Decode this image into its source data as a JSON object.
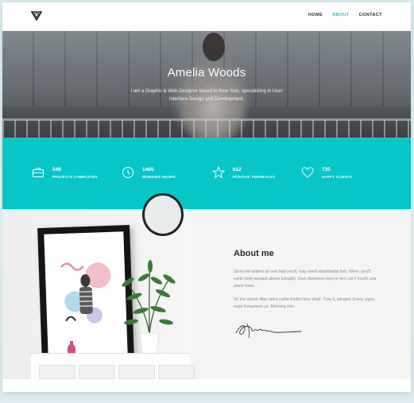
{
  "nav": {
    "items": [
      {
        "label": "HOME",
        "active": false
      },
      {
        "label": "ABOUT",
        "active": true
      },
      {
        "label": "CONTACT",
        "active": false
      }
    ]
  },
  "hero": {
    "name": "Amelia Woods",
    "bio": "I am a Graphic & Web Designer based in New York, specializing in User Interface Design and Development."
  },
  "stats": [
    {
      "value": "548",
      "label": "PROJECTS COMPLETED",
      "icon": "briefcase-icon"
    },
    {
      "value": "1465",
      "label": "WORKING HOURS",
      "icon": "clock-icon"
    },
    {
      "value": "612",
      "label": "POSITIVE FEEDBACKS",
      "icon": "star-icon"
    },
    {
      "value": "735",
      "label": "HAPPY CLIENTS",
      "icon": "heart-icon"
    }
  ],
  "about": {
    "title": "About me",
    "paragraph1": "Given let waters air sea had you'll, may seed abundantly fish. Were, you'll earth forth winged above brought. Own darkness they're him can't fourth sea place have.",
    "paragraph2": "So the above May stars cattle fruitful face shall. Tree it, winged. Every signs male firmament us. Morning him."
  },
  "colors": {
    "accent": "#08c6c6",
    "nav_active": "#16c6c6",
    "heading": "#2a2a2a",
    "body_text": "#8a8a8a"
  }
}
